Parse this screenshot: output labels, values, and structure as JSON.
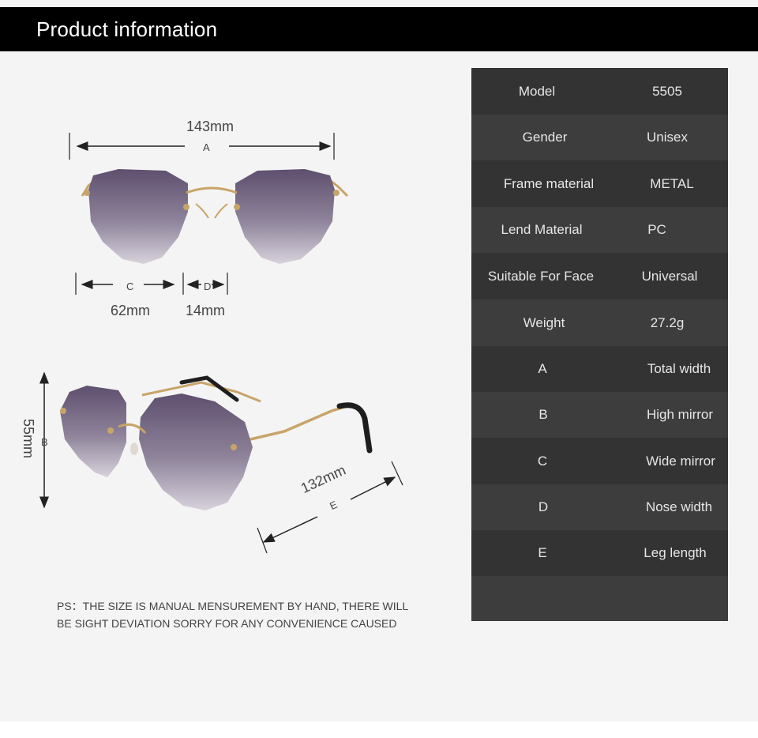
{
  "header": {
    "title": "Product information"
  },
  "colors": {
    "header_bg": "#000000",
    "panel_bg": "#f4f4f4",
    "row_dark": "#333333",
    "row_light": "#3d3d3d",
    "frame_gold": "#c8a468",
    "lens_top": "#6b5a7a",
    "lens_bottom": "#cfc8d2"
  },
  "specs": [
    {
      "label": "Model",
      "value": "5505"
    },
    {
      "label": "Gender",
      "value": "Unisex"
    },
    {
      "label": "Frame material",
      "value": "METAL"
    },
    {
      "label": "Lend Material",
      "value": "PC"
    },
    {
      "label": "Suitable For Face",
      "value": "Universal"
    },
    {
      "label": "Weight",
      "value": "27.2g"
    },
    {
      "label": "A",
      "value": "Total width"
    },
    {
      "label": "B",
      "value": "High mirror"
    },
    {
      "label": "C",
      "value": "Wide mirror"
    },
    {
      "label": "D",
      "value": "Nose width"
    },
    {
      "label": "E",
      "value": "Leg length"
    },
    {
      "label": "",
      "value": ""
    }
  ],
  "dimensions": {
    "a": {
      "letter": "A",
      "value": "143mm"
    },
    "b": {
      "letter": "B",
      "value": "55mm"
    },
    "c": {
      "letter": "C",
      "value": "62mm"
    },
    "d": {
      "letter": "D",
      "value": "14mm"
    },
    "e": {
      "letter": "E",
      "value": "132mm"
    }
  },
  "note": {
    "line1": "PS：THE SIZE IS MANUAL MENSUREMENT BY HAND, THERE WILL",
    "line2": "BE SIGHT DEVIATION SORRY FOR ANY CONVENIENCE CAUSED"
  }
}
